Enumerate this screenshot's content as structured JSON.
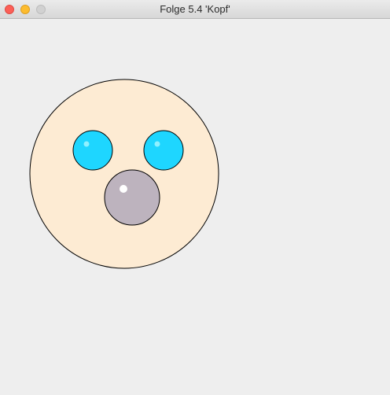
{
  "window": {
    "title": "Folge 5.4 'Kopf'"
  },
  "icons": {
    "close": "close-icon",
    "minimize": "minimize-icon",
    "zoom": "zoom-icon"
  },
  "colors": {
    "window_background": "#eeeeee",
    "close": "#fc5f57",
    "close_border": "#de4b43",
    "minimize": "#fdbc2e",
    "minimize_border": "#dd9f23",
    "zoom_disabled": "#d1d1d1",
    "zoom_border": "#bdbdbd",
    "face": "#fdebd3",
    "eye": "#1ed6ff",
    "nose": "#bdb3be",
    "highlight": "#ffffff",
    "outline": "#000000"
  }
}
